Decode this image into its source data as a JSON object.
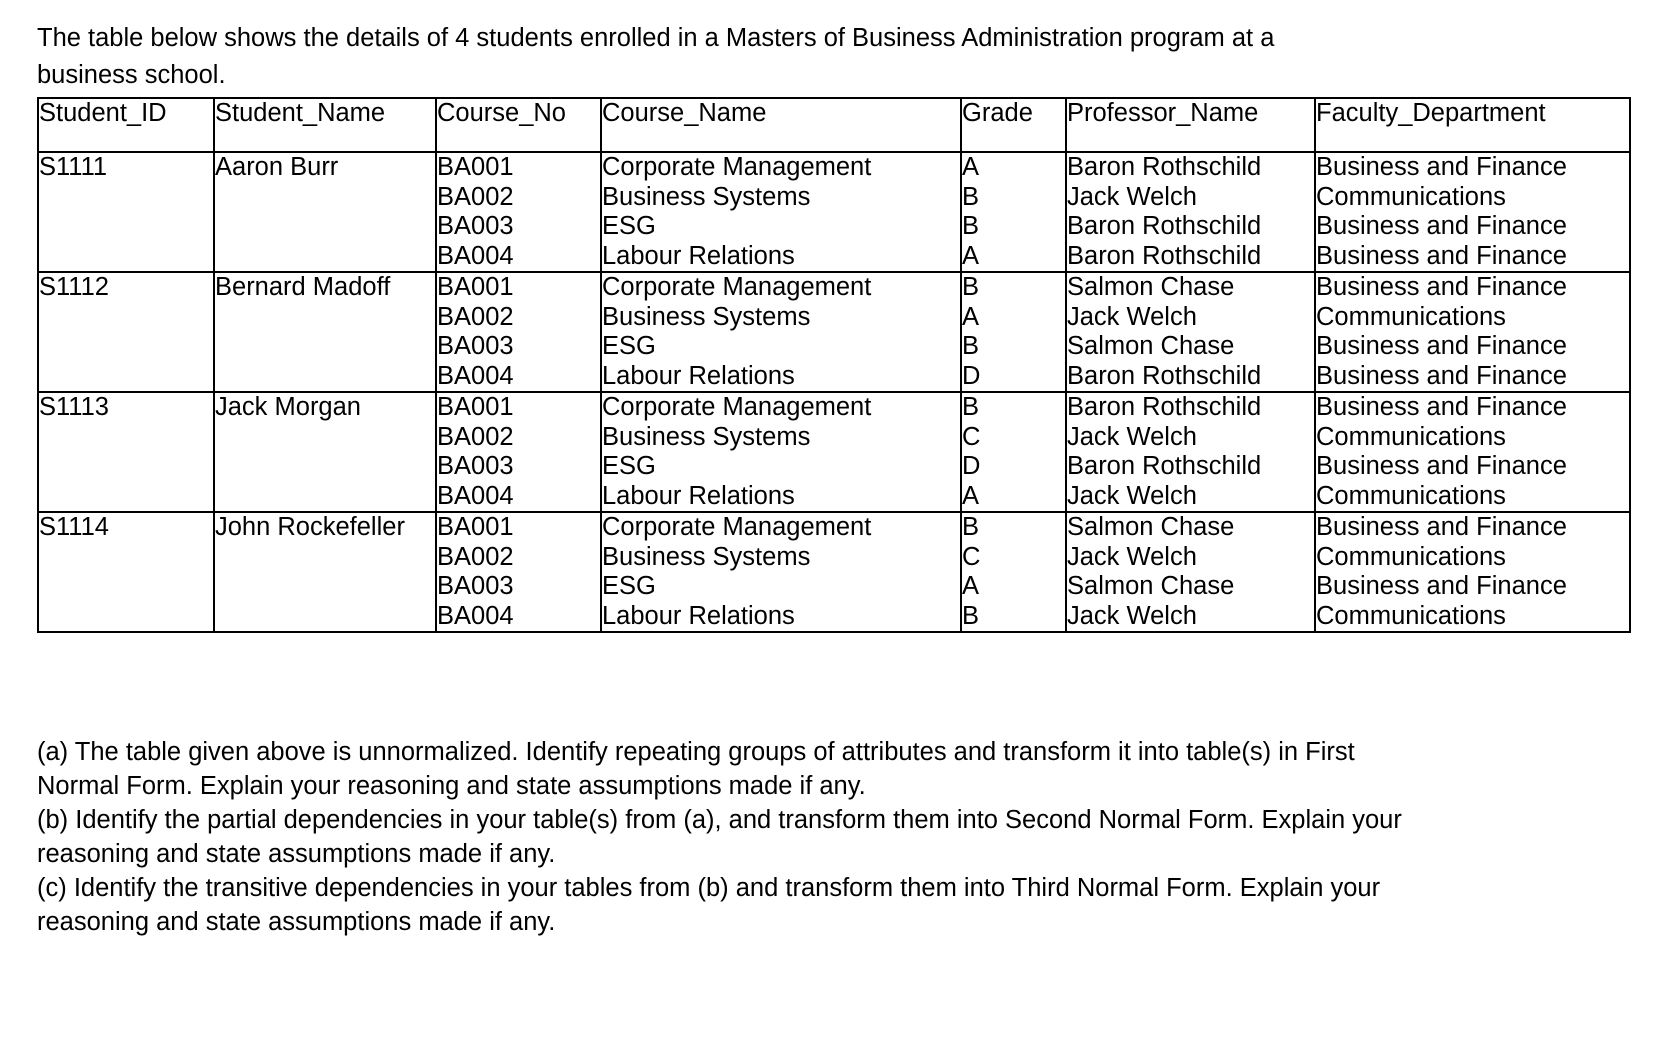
{
  "intro": {
    "text": "The table below shows the details of 4 students enrolled in a Masters of Business Administration program at a business school."
  },
  "table": {
    "headers": [
      "Student_ID",
      "Student_Name",
      "Course_No",
      "Course_Name",
      "Grade",
      "Professor_Name",
      "Faculty_Department"
    ],
    "rows": [
      {
        "student_id": "S1111",
        "student_name": "Aaron Burr",
        "course_no": "BA001\nBA002\nBA003\nBA004",
        "course_name": "Corporate Management\nBusiness Systems\nESG\nLabour Relations",
        "grade": "A\nB\nB\nA",
        "professor_name": "Baron Rothschild\nJack Welch\nBaron Rothschild\nBaron Rothschild",
        "faculty_department": "Business and Finance\nCommunications\nBusiness and Finance\nBusiness and Finance"
      },
      {
        "student_id": "S1112",
        "student_name": "Bernard Madoff",
        "course_no": "BA001\nBA002\nBA003\nBA004",
        "course_name": "Corporate Management\nBusiness Systems\nESG\nLabour Relations",
        "grade": "B\nA\nB\nD",
        "professor_name": "Salmon Chase\nJack Welch\nSalmon Chase\nBaron Rothschild",
        "faculty_department": "Business and Finance\nCommunications\nBusiness and Finance\nBusiness and Finance"
      },
      {
        "student_id": "S1113",
        "student_name": "Jack Morgan",
        "course_no": "BA001\nBA002\nBA003\nBA004",
        "course_name": "Corporate Management\nBusiness Systems\nESG\nLabour Relations",
        "grade": "B\nC\nD\nA",
        "professor_name": "Baron Rothschild\nJack Welch\nBaron Rothschild\nJack Welch",
        "faculty_department": "Business and Finance\nCommunications\nBusiness and Finance\nCommunications"
      },
      {
        "student_id": "S1114",
        "student_name": "John Rockefeller",
        "course_no": "BA001\nBA002\nBA003\nBA004",
        "course_name": "Corporate Management\nBusiness Systems\nESG\nLabour Relations",
        "grade": "B\nC\nA\nB",
        "professor_name": "Salmon Chase\nJack Welch\nSalmon Chase\nJack Welch",
        "faculty_department": "Business and Finance\nCommunications\nBusiness and Finance\nCommunications"
      }
    ]
  },
  "questions": [
    "(a) The table given above is unnormalized. Identify repeating groups of attributes and transform it into table(s) in First Normal Form. Explain your reasoning and state assumptions made if any.",
    "(b) Identify the partial dependencies in your table(s) from (a), and transform them into Second Normal Form. Explain your reasoning and state assumptions made if any.",
    "(c) Identify the transitive dependencies in your tables from (b) and transform them into Third Normal Form. Explain your reasoning and state assumptions made if any."
  ]
}
